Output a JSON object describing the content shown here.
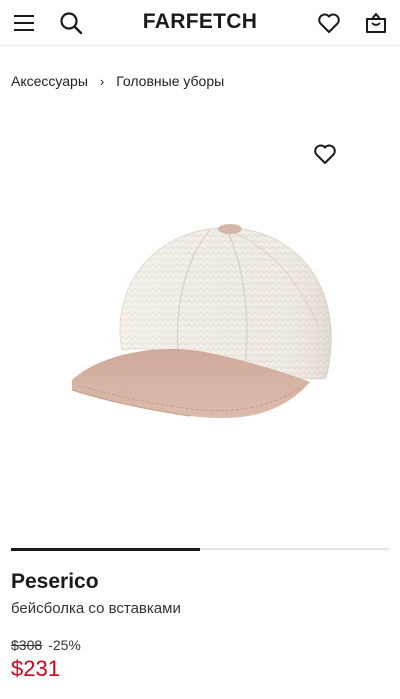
{
  "header": {
    "logo": "FARFETCH",
    "menu_icon": "hamburger-menu-icon",
    "search_icon": "search-icon",
    "wishlist_icon": "heart-icon",
    "bag_icon": "shopping-bag-icon"
  },
  "breadcrumb": {
    "items": [
      "Аксессуары",
      "Головные уборы"
    ],
    "separator": "›"
  },
  "product": {
    "image_alt": "бейсболка со вставками",
    "wishlist_icon": "heart-outline-icon",
    "gallery_progress": 0.5,
    "brand": "Peserico",
    "description": "бейсболка со вставками",
    "old_price": "$308",
    "discount": "-25%",
    "price": "$231"
  },
  "colors": {
    "sale": "#d0021b",
    "text": "#1a1a1a",
    "cap_crown": "#efe9e1",
    "cap_brim": "#d9b8a8"
  }
}
